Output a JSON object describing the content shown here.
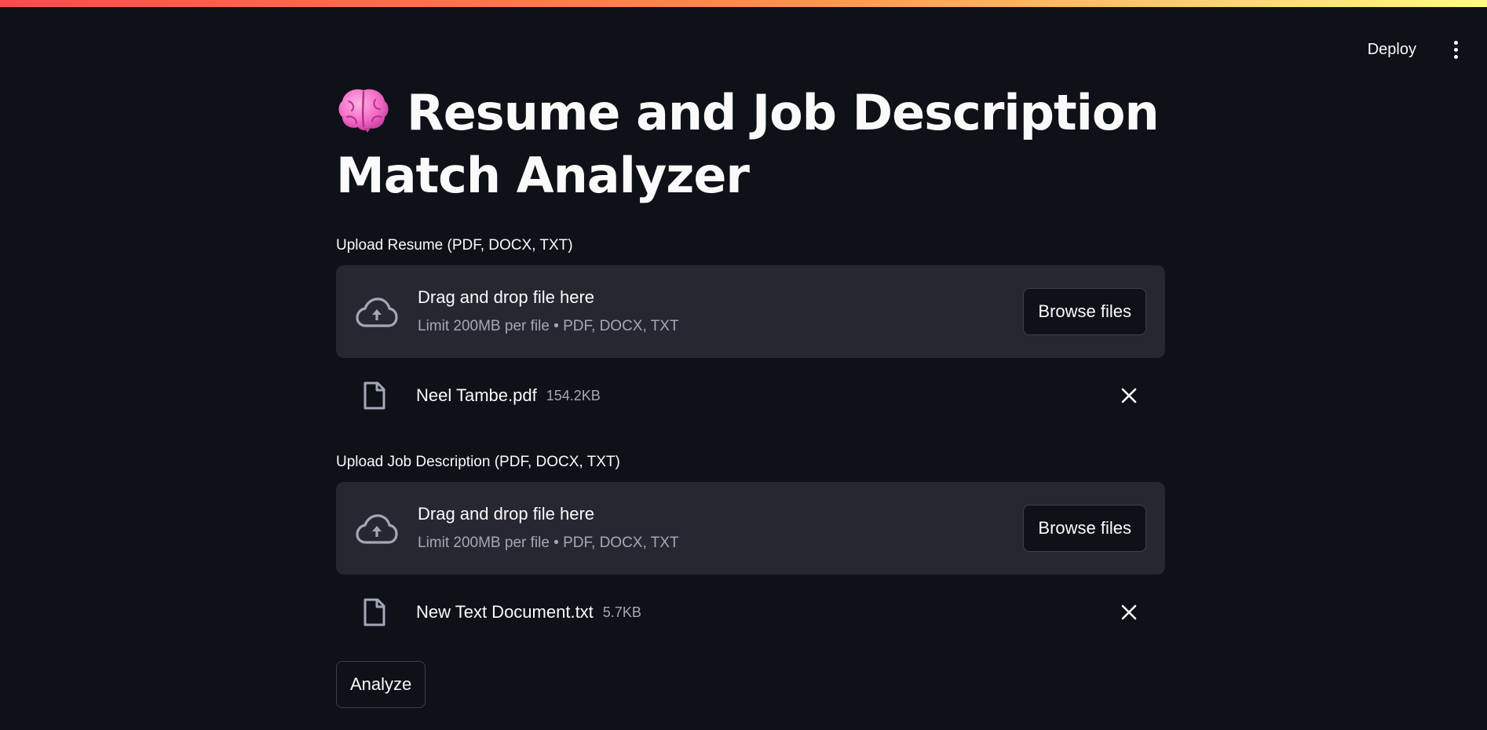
{
  "toolbar": {
    "deploy_label": "Deploy",
    "menu_icon": "more-vertical-icon"
  },
  "main": {
    "title_icon": "brain-emoji",
    "title": "Resume and Job Description Match Analyzer",
    "uploaders": [
      {
        "label": "Upload Resume (PDF, DOCX, TXT)",
        "dropzone_text": "Drag and drop file here",
        "dropzone_limit": "Limit 200MB per file • PDF, DOCX, TXT",
        "browse_label": "Browse files",
        "file": {
          "name": "Neel Tambe.pdf",
          "size": "154.2KB"
        }
      },
      {
        "label": "Upload Job Description (PDF, DOCX, TXT)",
        "dropzone_text": "Drag and drop file here",
        "dropzone_limit": "Limit 200MB per file • PDF, DOCX, TXT",
        "browse_label": "Browse files",
        "file": {
          "name": "New Text Document.txt",
          "size": "5.7KB"
        }
      }
    ],
    "analyze_label": "Analyze"
  },
  "colors": {
    "background": "#0e1117",
    "dropzone": "#262730",
    "text": "#fafafa",
    "muted_text": "#a3a8b8",
    "decoration_gradient": [
      "#ff4b4b",
      "#fffd80"
    ]
  }
}
